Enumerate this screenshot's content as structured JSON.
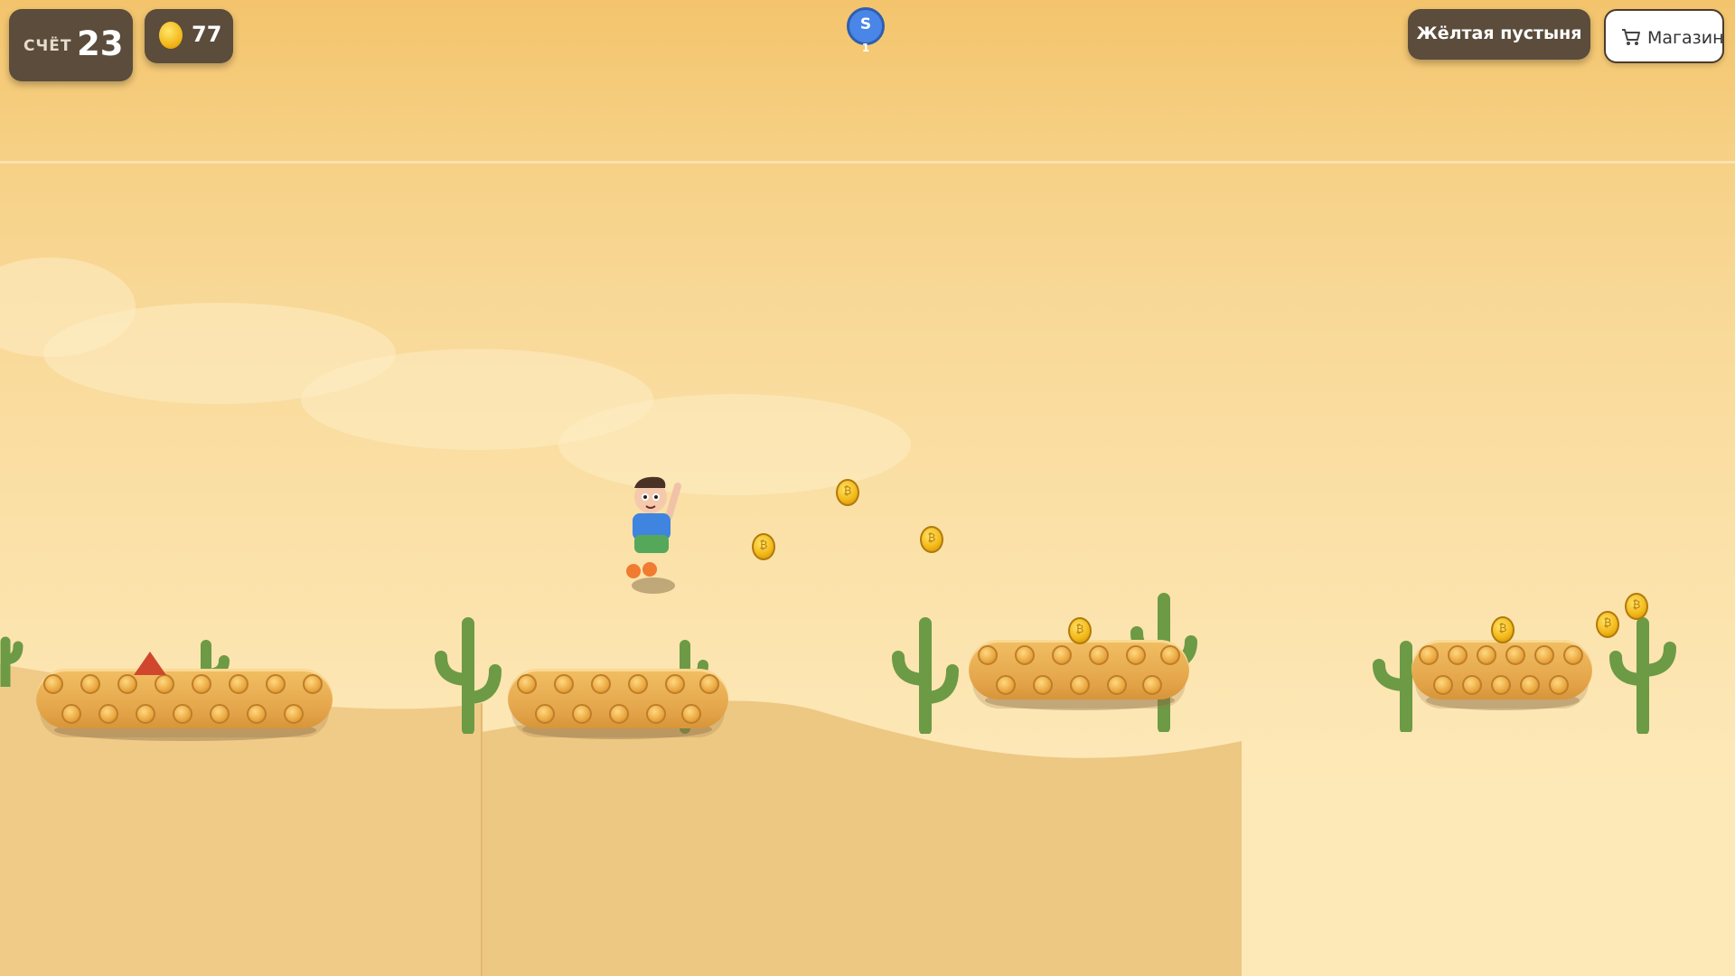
{
  "hud": {
    "score_label": "СЧЁТ",
    "score_value": "23",
    "coins_value": "77",
    "world_name": "Жёлтая пустыня",
    "shop_label": "Магазин"
  },
  "powerup": {
    "letter": "S",
    "count": "1"
  },
  "icons": {
    "coin": "coin-icon",
    "shop": "shopping-cart-icon",
    "powerup": "shield-icon"
  },
  "colors": {
    "sky_top": "#f3c46c",
    "sand": "#f0cd8a",
    "hud_bg": "#5b4c3b",
    "cactus": "#6d9a45",
    "platform": "#e6a84c",
    "spike": "#d0472e",
    "powerup": "#4a86e8"
  }
}
